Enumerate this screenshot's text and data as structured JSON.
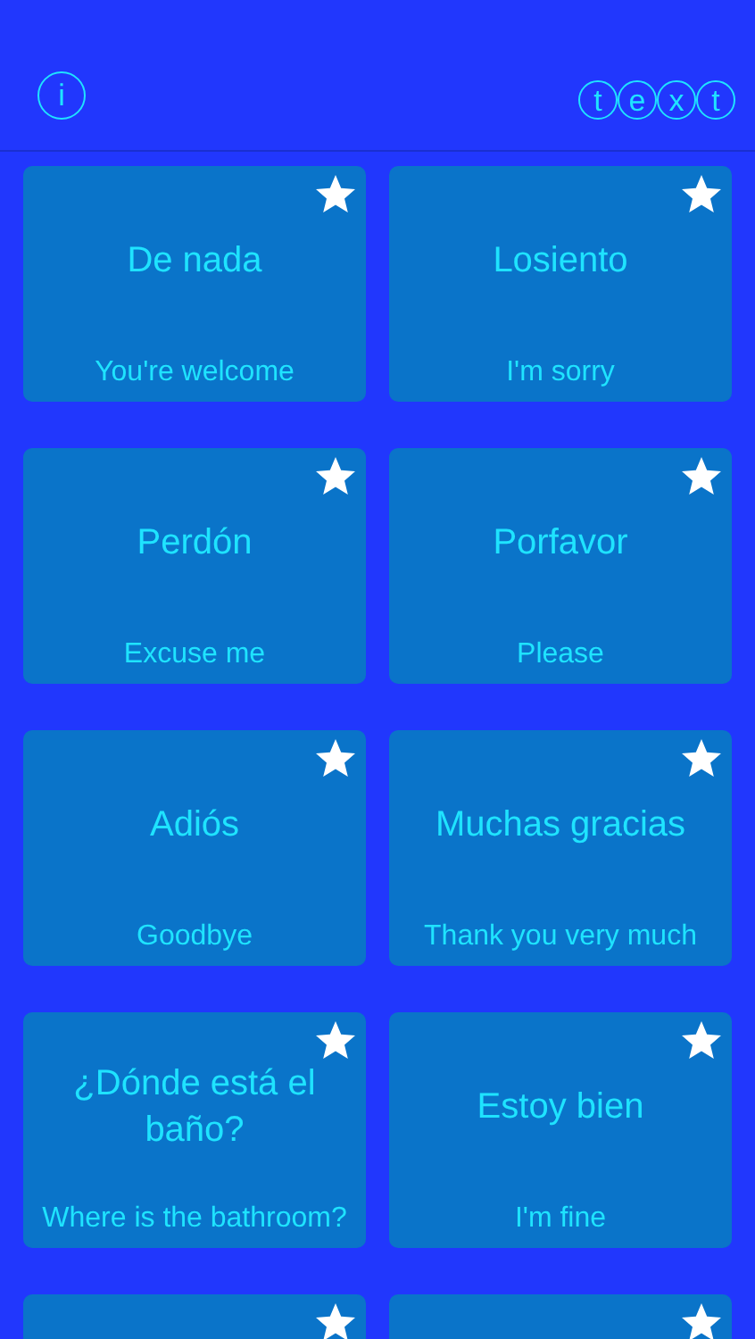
{
  "header": {
    "info_label": "i",
    "logo_letters": [
      "t",
      "e",
      "x",
      "t"
    ]
  },
  "cards": [
    {
      "kind": "phrase",
      "phrase": "De nada",
      "translation": "You're welcome"
    },
    {
      "kind": "phrase",
      "phrase": "Losiento",
      "translation": "I'm sorry"
    },
    {
      "kind": "phrase",
      "phrase": "Perdón",
      "translation": "Excuse me"
    },
    {
      "kind": "phrase",
      "phrase": "Porfavor",
      "translation": "Please"
    },
    {
      "kind": "phrase",
      "phrase": "Adiós",
      "translation": "Goodbye"
    },
    {
      "kind": "phrase",
      "phrase": "Muchas gracias",
      "translation": "Thank you very much"
    },
    {
      "kind": "phrase",
      "phrase": "¿Dónde está el baño?",
      "translation": "Where is the bathroom?"
    },
    {
      "kind": "phrase",
      "phrase": "Estoy bien",
      "translation": "I'm fine"
    },
    {
      "kind": "cut"
    },
    {
      "kind": "cut"
    }
  ]
}
